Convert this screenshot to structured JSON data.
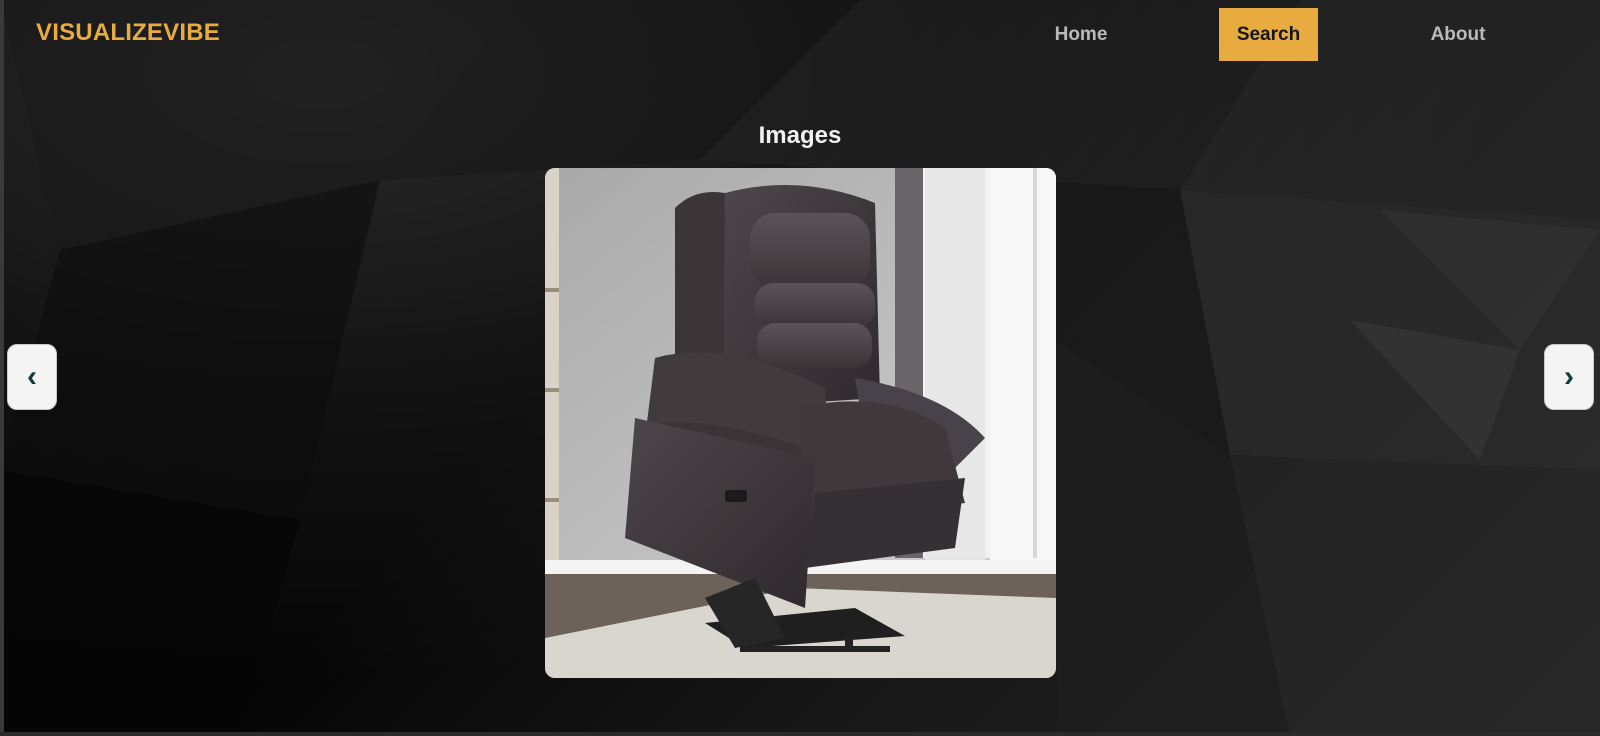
{
  "header": {
    "logo": "VISUALIZEVIBE",
    "nav": {
      "home": "Home",
      "search": "Search",
      "about": "About"
    },
    "active_item": "Search"
  },
  "main": {
    "title": "Images",
    "carousel": {
      "prev_symbol": "‹",
      "next_symbol": "›",
      "current_image": "power lift recliner chair in dark brown leather"
    }
  },
  "colors": {
    "accent": "#e8ab40",
    "background": "#0a0a0a",
    "nav_text": "#b9b9b9"
  }
}
